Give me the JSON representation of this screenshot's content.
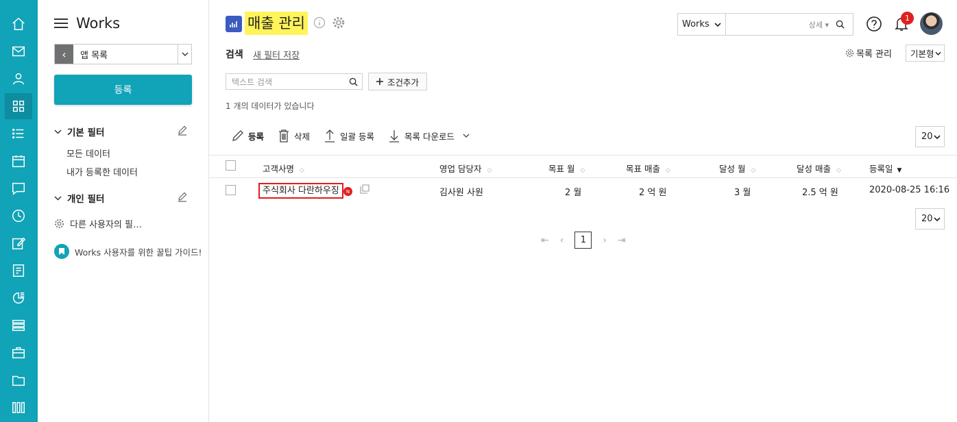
{
  "rail": {
    "items": [
      "home",
      "mail",
      "contacts",
      "apps",
      "tasks",
      "calendar",
      "messenger",
      "clock",
      "board",
      "approval",
      "reports",
      "list",
      "equipment",
      "folder",
      "library"
    ],
    "active_index": 3,
    "color": "#11a3b7"
  },
  "sidebar": {
    "brand": "Works",
    "app_list_label": "앱 목록",
    "register_button": "등록",
    "basic_filter": {
      "title": "기본 필터",
      "items": [
        "모든 데이터",
        "내가 등록한 데이터"
      ]
    },
    "personal_filter": {
      "title": "개인 필터"
    },
    "other_users_filter": "다른 사용자의 필…",
    "guide_link": "Works 사용자를 위한 꿀팁 가이드!"
  },
  "header": {
    "app_title": "매출 관리",
    "search_scope": "Works",
    "search_detail": "상세",
    "notification_count": "1"
  },
  "filters": {
    "tab_search": "검색",
    "save_new_filter": "새 필터 저장",
    "list_manage": "목록 관리",
    "view_type": "기본형",
    "text_search_placeholder": "텍스트 검색",
    "add_condition": "조건추가",
    "result_count": "1 개의 데이터가 있습니다"
  },
  "toolbar": {
    "register": "등록",
    "delete": "삭제",
    "bulk_register": "일괄 등록",
    "download": "목록 다운로드",
    "page_size": "20"
  },
  "table": {
    "columns": [
      "고객사명",
      "영업 담당자",
      "목표 월",
      "목표 매출",
      "달성 월",
      "달성 매출",
      "등록일"
    ],
    "rows": [
      {
        "customer": "주식회사 다란하우징",
        "new_badge": "N",
        "manager": "김사원 사원",
        "target_month": "2 월",
        "target_sales": "2 억 원",
        "achieved_month": "3 월",
        "achieved_sales": "2.5 억 원",
        "registered": "2020-08-25 16:16"
      }
    ]
  },
  "pagination": {
    "current_page": "1",
    "page_size": "20"
  }
}
